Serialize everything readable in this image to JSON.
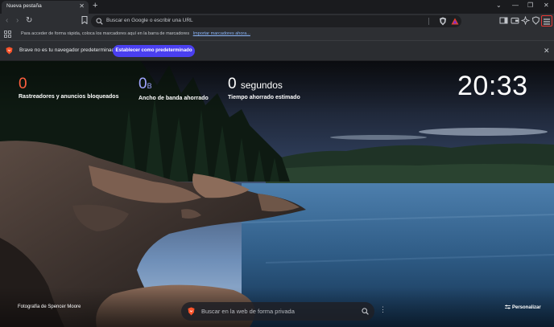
{
  "tab": {
    "title": "Nueva pestaña"
  },
  "toolbar": {
    "url_placeholder": "Buscar en Google o escribir una URL"
  },
  "bookmarks_bar": {
    "text": "Para acceder de forma rápida, coloca los marcadores aquí en la barra de marcadores",
    "link": "Importar marcadores ahora..."
  },
  "infobar": {
    "text": "Brave no es tu navegador predeterminado",
    "button": "Establecer como predeterminado"
  },
  "stats": [
    {
      "value": "0",
      "unit": "",
      "label": "Rastreadores y anuncios bloqueados",
      "color": "#ff5f3f"
    },
    {
      "value": "0",
      "unit": "B",
      "label": "Ancho de banda ahorrado",
      "color": "#a0a5ff"
    },
    {
      "value": "0",
      "unit": "segundos",
      "label": "Tiempo ahorrado estimado",
      "color": "#ffffff"
    }
  ],
  "clock": "20:33",
  "photo_credit": "Fotografía de Spencer Moore",
  "search": {
    "placeholder": "Buscar en la web de forma privada"
  },
  "customize": "Personalizar",
  "colors": {
    "accent": "#4a3ff0",
    "brave_orange": "#fb542b",
    "menu_highlight": "#e53935"
  }
}
